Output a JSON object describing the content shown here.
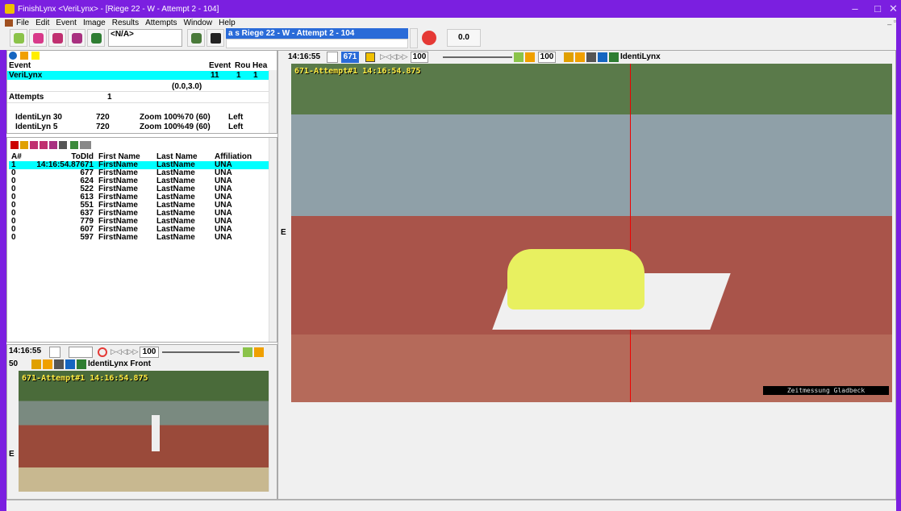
{
  "window": {
    "title": "FinishLynx <VeriLynx> - [Riege 22 - W - Attempt 2 - 104]",
    "minimize": "–",
    "maximize": "□",
    "close": "✕"
  },
  "menu": {
    "items": [
      "File",
      "Edit",
      "Event",
      "Image",
      "Results",
      "Attempts",
      "Window",
      "Help"
    ],
    "mdi_controls": "_ ▫"
  },
  "toolbar": {
    "na_label": "<N/A>",
    "event_select": "a   s   Riege 22 - W - Attempt 2 - 104",
    "value": "0.0"
  },
  "event_panel": {
    "headers": {
      "event": "Event",
      "event_col": "Event",
      "round_col": "Rou",
      "heat_col": "Hea"
    },
    "row_name": "VeriLynx",
    "row_event": "11",
    "row_round": "1",
    "row_heat": "1",
    "coords": "(0.0,3.0)",
    "attempts_label": "Attempts",
    "attempts_value": "1",
    "cameras": [
      {
        "name": "IdentiLyn 30",
        "res": "720",
        "zoom": "Zoom 100%",
        "fps": "70 (60)",
        "side": "Left"
      },
      {
        "name": "IdentiLyn 5",
        "res": "720",
        "zoom": "Zoom 100%",
        "fps": "49 (60)",
        "side": "Left"
      }
    ]
  },
  "results": {
    "columns": [
      "A#",
      "ToDId",
      "First Name",
      "Last Name",
      "Affiliation"
    ],
    "rows": [
      {
        "a": "1",
        "time": "14:16:54.87",
        "id": "671",
        "first": "FirstName",
        "last": "LastName",
        "aff": "UNA"
      },
      {
        "a": "0",
        "time": "",
        "id": "677",
        "first": "FirstName",
        "last": "LastName",
        "aff": "UNA"
      },
      {
        "a": "0",
        "time": "",
        "id": "624",
        "first": "FirstName",
        "last": "LastName",
        "aff": "UNA"
      },
      {
        "a": "0",
        "time": "",
        "id": "522",
        "first": "FirstName",
        "last": "LastName",
        "aff": "UNA"
      },
      {
        "a": "0",
        "time": "",
        "id": "613",
        "first": "FirstName",
        "last": "LastName",
        "aff": "UNA"
      },
      {
        "a": "0",
        "time": "",
        "id": "551",
        "first": "FirstName",
        "last": "LastName",
        "aff": "UNA"
      },
      {
        "a": "0",
        "time": "",
        "id": "637",
        "first": "FirstName",
        "last": "LastName",
        "aff": "UNA"
      },
      {
        "a": "0",
        "time": "",
        "id": "779",
        "first": "FirstName",
        "last": "LastName",
        "aff": "UNA"
      },
      {
        "a": "0",
        "time": "",
        "id": "607",
        "first": "FirstName",
        "last": "LastName",
        "aff": "UNA"
      },
      {
        "a": "0",
        "time": "",
        "id": "597",
        "first": "FirstName",
        "last": "LastName",
        "aff": "UNA"
      }
    ]
  },
  "small_view": {
    "time": "14:16:55",
    "zoom": "100",
    "scale": "50",
    "camera": "IdentiLynx Front",
    "overlay": "671-Attempt#1  14:16:54.875",
    "edge_label": "E"
  },
  "main_view": {
    "time": "14:16:55",
    "id": "671",
    "zoom": "100",
    "zoom2": "100",
    "camera": "IdentiLynx",
    "overlay": "671-Attempt#1  14:16:54.875",
    "watermark": "Zeitmessung Gladbeck",
    "edge_label": "E"
  }
}
